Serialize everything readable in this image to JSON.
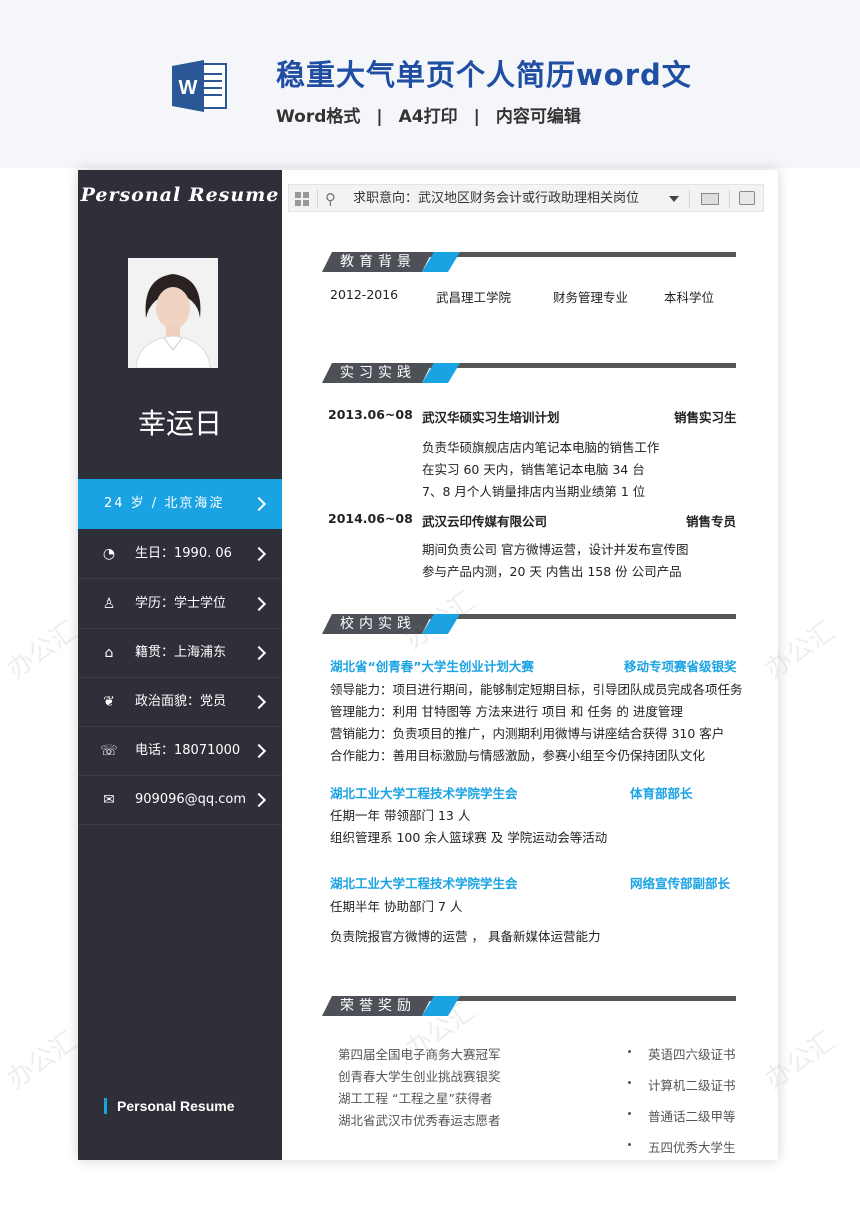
{
  "banner": {
    "title": "稳重大气单页个人简历word文",
    "sub": [
      "Word格式",
      "A4打印",
      "内容可编辑"
    ],
    "sep": "|"
  },
  "sidebar": {
    "script_title": "Personal  Resume",
    "name": "幸运日",
    "age_location": "24 岁  /  北京海淀",
    "items": [
      {
        "icon": "clock-icon",
        "glyph": "◔",
        "text": "生日：1990. 06"
      },
      {
        "icon": "person-icon",
        "glyph": "♙",
        "text": "学历：学士学位"
      },
      {
        "icon": "home-icon",
        "glyph": "⌂",
        "text": "籍贯：上海浦东"
      },
      {
        "icon": "leaf-icon",
        "glyph": "❦",
        "text": "政治面貌：党员"
      },
      {
        "icon": "phone-icon",
        "glyph": "☏",
        "text": "电话：18071000"
      },
      {
        "icon": "mail-icon",
        "glyph": "✉",
        "text": "909096@qq.com"
      }
    ],
    "footer": "Personal   Resume"
  },
  "search": {
    "text": "求职意向：武汉地区财务会计或行政助理相关岗位"
  },
  "education": {
    "title": "教育背景",
    "period": "2012-2016",
    "school": "武昌理工学院",
    "major": "财务管理专业",
    "degree": "本科学位"
  },
  "internship": {
    "title": "实习实践",
    "jobs": [
      {
        "date": "2013.06~08",
        "company": "武汉华硕实习生培训计划",
        "role": "销售实习生",
        "lines": [
          "负责华硕旗舰店店内笔记本电脑的销售工作",
          "在实习 60 天内，销售笔记本电脑 34 台",
          "7、8 月个人销量排店内当期业绩第 1 位"
        ]
      },
      {
        "date": "2014.06~08",
        "company": "武汉云印传媒有限公司",
        "role": "销售专员",
        "lines": [
          "期间负责公司  官方微博运营，设计并发布宣传图",
          "参与产品内测，20 天  内售出  158 份  公司产品"
        ]
      }
    ]
  },
  "campus": {
    "title": "校内实践",
    "blocks": [
      {
        "org": "湖北省“创青春”大学生创业计划大赛",
        "role": "移动专项赛省级银奖",
        "lines": [
          "领导能力：项目进行期间，能够制定短期目标，引导团队成员完成各项任务",
          "管理能力：利用    甘特图等    方法来进行  项目  和  任务  的  进度管理",
          "营销能力：负责项目的推广，内测期利用微博与讲座结合获得 310 客户",
          "合作能力：善用目标激励与情感激励，参赛小组至今仍保持团队文化"
        ]
      },
      {
        "org": "湖北工业大学工程技术学院学生会",
        "role": "体育部部长",
        "lines": [
          "任期一年          带领部门 13 人",
          "组织管理系 100 余人篮球赛      及        学院运动会等活动"
        ]
      },
      {
        "org": "湖北工业大学工程技术学院学生会",
        "role": "网络宣传部副部长",
        "lines": [
          "任期半年          协助部门 7 人",
          "负责院报官方微博的运营      ，      具备新媒体运营能力"
        ]
      }
    ]
  },
  "honors": {
    "title": "荣誉奖励",
    "left": [
      "第四届全国电子商务大赛冠军",
      "创青春大学生创业挑战赛银奖",
      "湖工工程  “工程之星”获得者",
      "湖北省武汉市优秀春运志愿者"
    ],
    "right": [
      "英语四六级证书",
      "计算机二级证书",
      "普通话二级甲等",
      "五四优秀大学生"
    ]
  },
  "watermark": "办公汇",
  "colors": {
    "accent": "#1aa3e3",
    "sidebar": "#2e2f38",
    "brand": "#1f4ea3"
  }
}
